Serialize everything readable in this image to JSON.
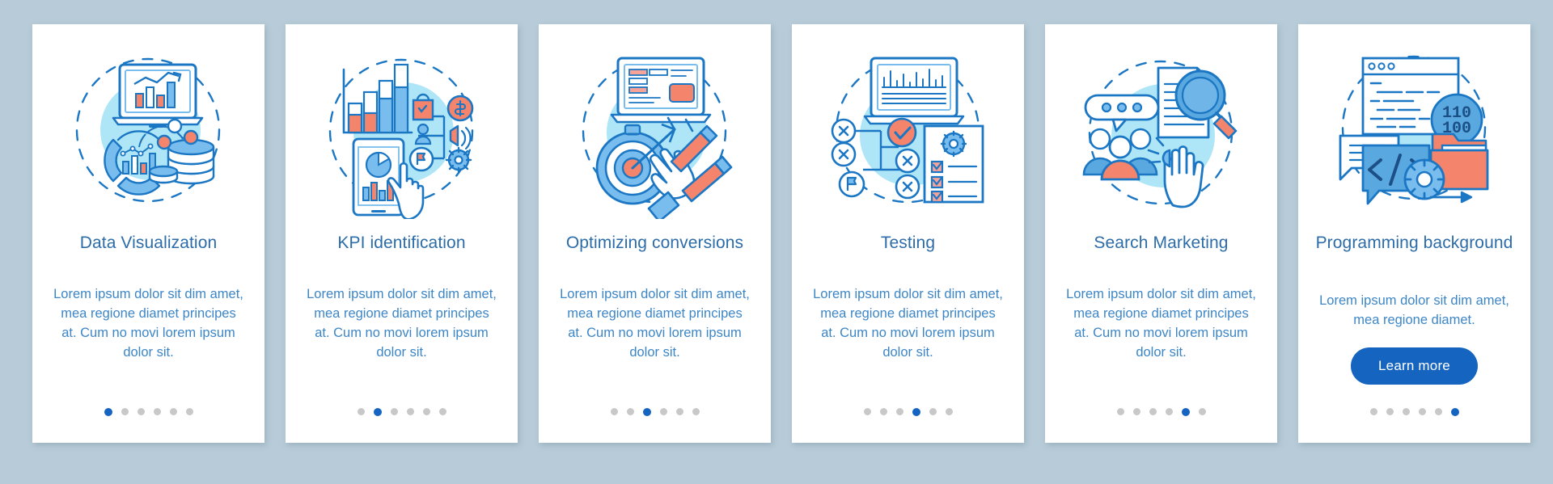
{
  "theme": {
    "background": "#b7cbd8",
    "card_background": "#ffffff",
    "title_color": "#2c6ca8",
    "body_color": "#3d86c6",
    "accent_blue": "#1565c0",
    "icon_blue": "#1b77c4",
    "icon_light_blue": "#79bdee",
    "icon_pale_blue": "#aee1f4",
    "icon_coral": "#f4846b",
    "dot_inactive": "#c8c8c8"
  },
  "total_steps": 6,
  "cards": [
    {
      "id": "data-visualization",
      "illustration": "laptop-bar-chart-donut-coins-icon",
      "title": "Data Visualization",
      "description": "Lorem ipsum dolor sit dim amet, mea regione diamet principes at. Cum no movi lorem ipsum dolor sit.",
      "active_dot": 1,
      "has_button": false,
      "button_label": ""
    },
    {
      "id": "kpi-identification",
      "illustration": "bar-chart-phone-pie-hand-cursor-icon",
      "title": "KPI identification",
      "description": "Lorem ipsum dolor sit dim amet, mea regione diamet principes at. Cum no movi lorem ipsum dolor sit.",
      "active_dot": 2,
      "has_button": false,
      "button_label": ""
    },
    {
      "id": "optimizing-conversions",
      "illustration": "laptop-stopwatch-target-hand-pencil-icon",
      "title": "Optimizing conversions",
      "description": "Lorem ipsum dolor sit dim amet, mea regione diamet principes at. Cum no movi lorem ipsum dolor sit.",
      "active_dot": 3,
      "has_button": false,
      "button_label": ""
    },
    {
      "id": "testing",
      "illustration": "laptop-flowchart-checklist-icon",
      "title": "Testing",
      "description": "Lorem ipsum dolor sit dim amet, mea regione diamet principes at. Cum no movi lorem ipsum dolor sit.",
      "active_dot": 4,
      "has_button": false,
      "button_label": ""
    },
    {
      "id": "search-marketing",
      "illustration": "people-group-document-magnifier-hand-icon",
      "title": "Search Marketing",
      "description": "Lorem ipsum dolor sit dim amet, mea regione diamet principes at. Cum no movi lorem ipsum dolor sit.",
      "active_dot": 5,
      "has_button": false,
      "button_label": ""
    },
    {
      "id": "programming-background",
      "illustration": "code-window-binary-chat-folder-gear-icon",
      "title": "Programming background",
      "description": "Lorem ipsum dolor sit dim amet, mea regione diamet.",
      "active_dot": 6,
      "has_button": true,
      "button_label": "Learn more"
    }
  ]
}
